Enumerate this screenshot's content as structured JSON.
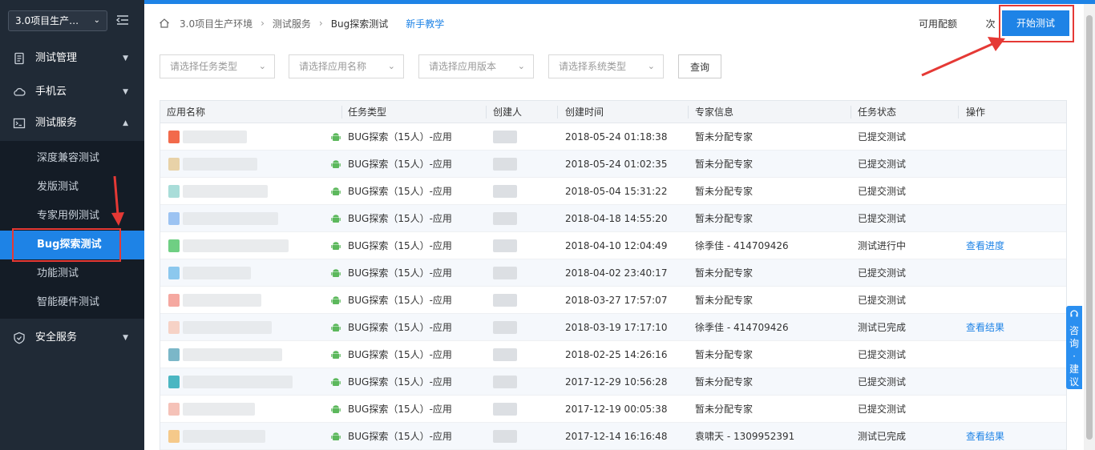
{
  "sidebar": {
    "project": "3.0项目生产…",
    "menus": [
      {
        "label": "测试管理",
        "icon": "document-icon"
      },
      {
        "label": "手机云",
        "icon": "cloud-icon"
      },
      {
        "label": "测试服务",
        "icon": "terminal-icon"
      },
      {
        "label": "安全服务",
        "icon": "shield-icon"
      }
    ],
    "submenu": [
      "深度兼容测试",
      "发版测试",
      "专家用例测试",
      "Bug探索测试",
      "功能测试",
      "智能硬件测试"
    ]
  },
  "breadcrumb": {
    "items": [
      "3.0项目生产环境",
      "测试服务",
      "Bug探索测试"
    ],
    "guide": "新手教学"
  },
  "header": {
    "quota_label": "可用配额",
    "quota_unit": "次",
    "start_button": "开始测试"
  },
  "filters": {
    "task_type": "请选择任务类型",
    "app_name": "请选择应用名称",
    "app_version": "请选择应用版本",
    "os_type": "请选择系统类型",
    "query": "查询"
  },
  "table": {
    "columns": [
      "应用名称",
      "任务类型",
      "创建人",
      "创建时间",
      "专家信息",
      "任务状态",
      "操作"
    ],
    "rows": [
      {
        "type": "BUG探索（15人）-应用",
        "time": "2018-05-24 01:18:38",
        "expert": "暂未分配专家",
        "status": "已提交测试",
        "action": ""
      },
      {
        "type": "BUG探索（15人）-应用",
        "time": "2018-05-24 01:02:35",
        "expert": "暂未分配专家",
        "status": "已提交测试",
        "action": ""
      },
      {
        "type": "BUG探索（15人）-应用",
        "time": "2018-05-04 15:31:22",
        "expert": "暂未分配专家",
        "status": "已提交测试",
        "action": ""
      },
      {
        "type": "BUG探索（15人）-应用",
        "time": "2018-04-18 14:55:20",
        "expert": "暂未分配专家",
        "status": "已提交测试",
        "action": ""
      },
      {
        "type": "BUG探索（15人）-应用",
        "time": "2018-04-10 12:04:49",
        "expert": "徐季佳 - 414709426",
        "status": "测试进行中",
        "action": "查看进度"
      },
      {
        "type": "BUG探索（15人）-应用",
        "time": "2018-04-02 23:40:17",
        "expert": "暂未分配专家",
        "status": "已提交测试",
        "action": ""
      },
      {
        "type": "BUG探索（15人）-应用",
        "time": "2018-03-27 17:57:07",
        "expert": "暂未分配专家",
        "status": "已提交测试",
        "action": ""
      },
      {
        "type": "BUG探索（15人）-应用",
        "time": "2018-03-19 17:17:10",
        "expert": "徐季佳 - 414709426",
        "status": "测试已完成",
        "action": "查看结果"
      },
      {
        "type": "BUG探索（15人）-应用",
        "time": "2018-02-25 14:26:16",
        "expert": "暂未分配专家",
        "status": "已提交测试",
        "action": ""
      },
      {
        "type": "BUG探索（15人）-应用",
        "time": "2017-12-29 10:56:28",
        "expert": "暂未分配专家",
        "status": "已提交测试",
        "action": ""
      },
      {
        "type": "BUG探索（15人）-应用",
        "time": "2017-12-19 00:05:38",
        "expert": "暂未分配专家",
        "status": "已提交测试",
        "action": ""
      },
      {
        "type": "BUG探索（15人）-应用",
        "time": "2017-12-14 16:16:48",
        "expert": "袁啸天 - 1309952391",
        "status": "测试已完成",
        "action": "查看结果"
      }
    ]
  },
  "consult_tab": "咨询·建议",
  "colors": {
    "accent": "#1e83e6",
    "sidebar_bg": "#202a36",
    "annotation_red": "#e53935"
  }
}
